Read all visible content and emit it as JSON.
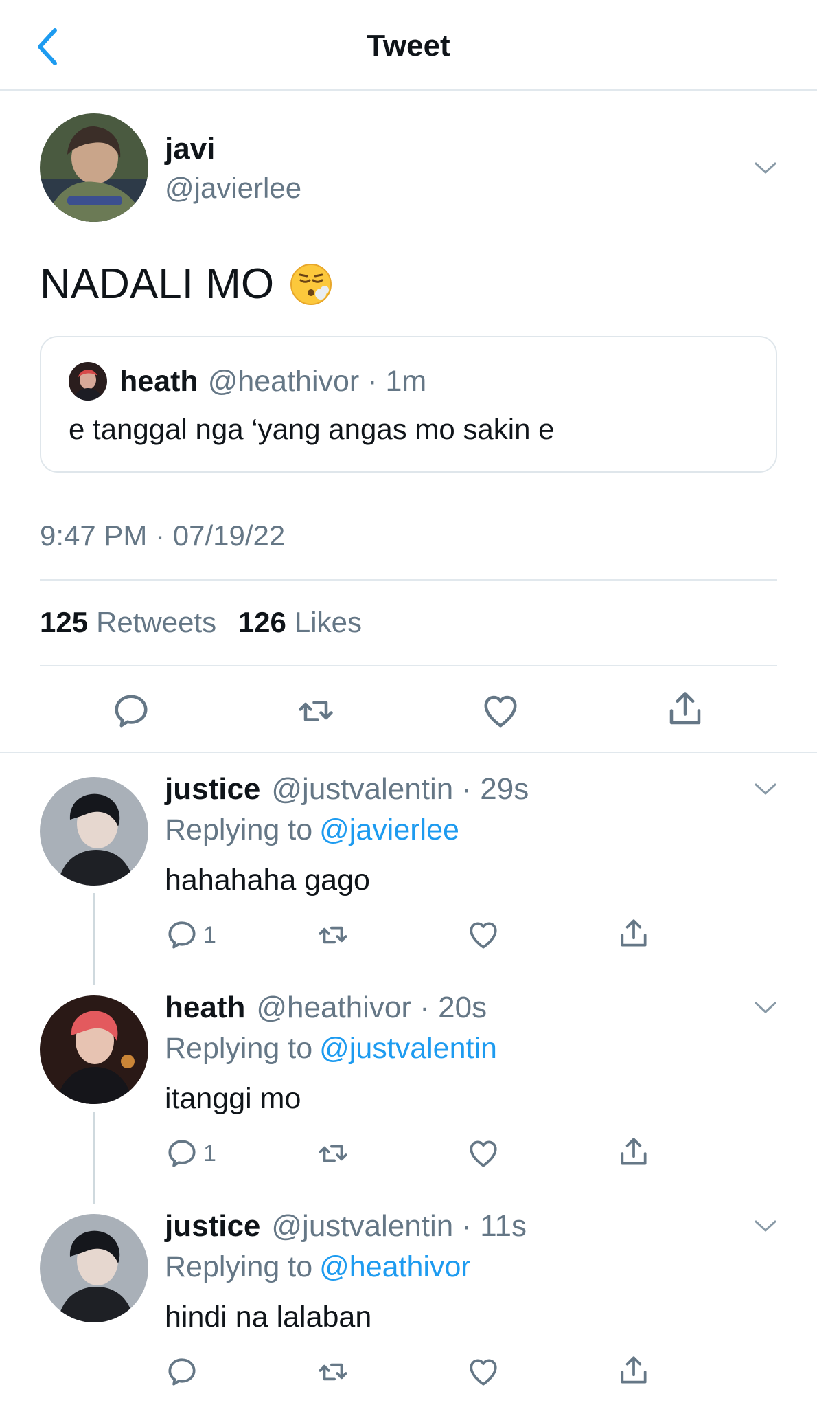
{
  "header": {
    "title": "Tweet",
    "back_icon": "chevron-left-icon"
  },
  "colors": {
    "link": "#1d9bf0",
    "secondary": "#657786",
    "divider": "#e1e8ed"
  },
  "main_tweet": {
    "name": "javi",
    "handle": "@javierlee",
    "text": "NADALI MO",
    "emoji": "😮‍💨",
    "quote": {
      "name": "heath",
      "handle": "@heathivor · 1m",
      "text": "e tanggal nga ‘yang angas mo sakin e"
    },
    "timestamp": "9:47 PM · 07/19/22",
    "retweets": "125",
    "retweets_label": "Retweets",
    "likes": "126",
    "likes_label": "Likes"
  },
  "replies": [
    {
      "name": "justice",
      "handle": "@justvalentin · 29s",
      "replying_prefix": "Replying to",
      "replying_to": "@javierlee",
      "text": "hahahaha gago",
      "reply_count": "1"
    },
    {
      "name": "heath",
      "handle": "@heathivor · 20s",
      "replying_prefix": "Replying to",
      "replying_to": "@justvalentin",
      "text": "itanggi mo",
      "reply_count": "1"
    },
    {
      "name": "justice",
      "handle": "@justvalentin · 11s",
      "replying_prefix": "Replying to",
      "replying_to": "@heathivor",
      "text": "hindi na lalaban",
      "reply_count": ""
    }
  ]
}
